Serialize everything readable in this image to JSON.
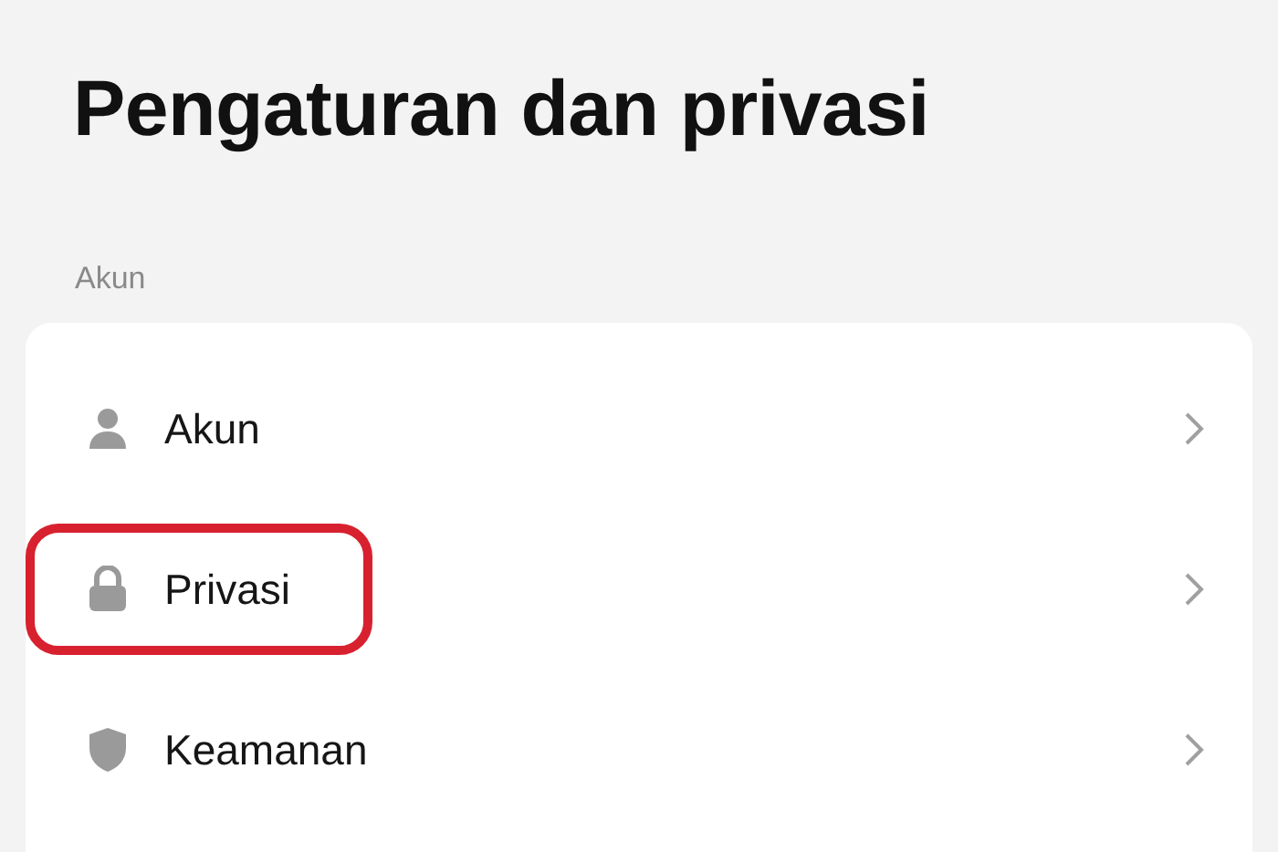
{
  "title": "Pengaturan dan privasi",
  "section": {
    "label": "Akun",
    "items": [
      {
        "kind": "person",
        "label": "Akun",
        "highlighted": false
      },
      {
        "kind": "lock",
        "label": "Privasi",
        "highlighted": true
      },
      {
        "kind": "shield",
        "label": "Keamanan",
        "highlighted": false
      }
    ]
  }
}
